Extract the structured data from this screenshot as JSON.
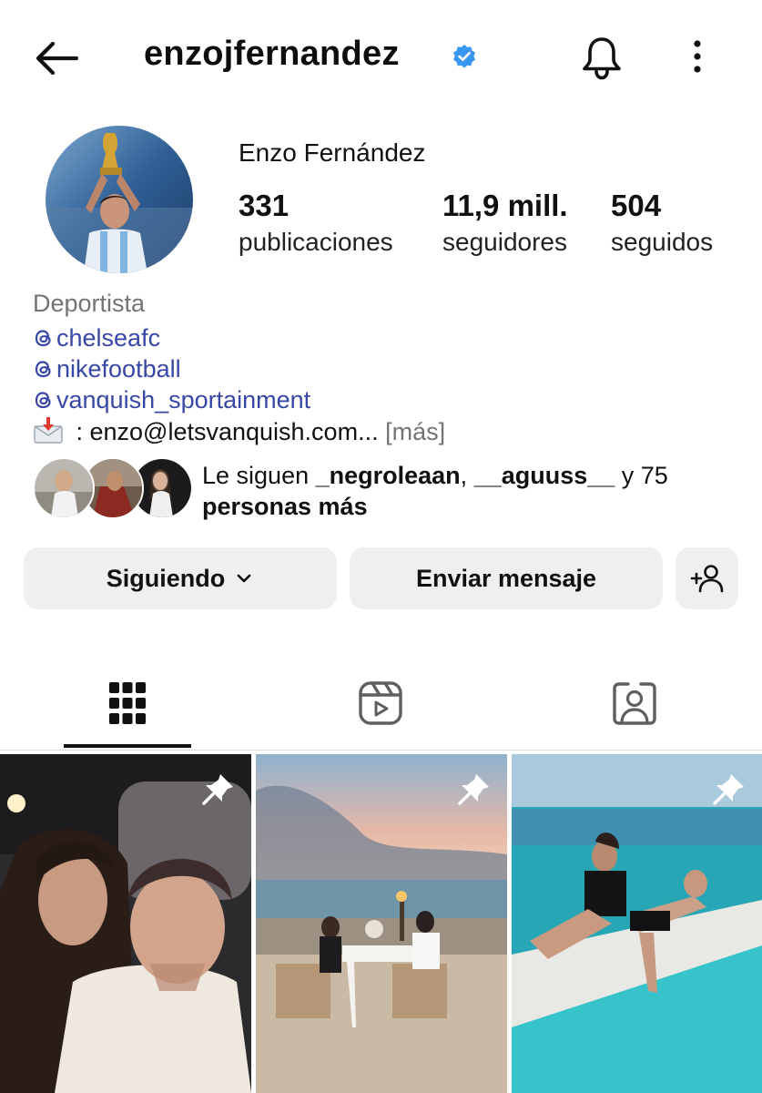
{
  "header": {
    "username": "enzojfernandez",
    "icons": {
      "back": "arrow-left-icon",
      "verified": "verified-badge-icon",
      "notifications": "bell-icon",
      "more": "more-vertical-icon"
    },
    "verified_color": "#3897f0"
  },
  "profile": {
    "full_name": "Enzo Fernández",
    "stats": {
      "posts": {
        "value": "331",
        "label": "publicaciones"
      },
      "followers": {
        "value": "11,9 mill.",
        "label": "seguidores"
      },
      "following": {
        "value": "504",
        "label": "seguidos"
      }
    },
    "category": "Deportista",
    "links": [
      {
        "icon": "threads-icon",
        "text": "chelseafc"
      },
      {
        "icon": "threads-icon",
        "text": "nikefootball"
      },
      {
        "icon": "threads-icon",
        "text": "vanquish_sportainment"
      }
    ],
    "bio_email": " : enzo@letsvanquish.com...",
    "bio_more": "[más]",
    "link_color": "#3847a6",
    "mutual": {
      "prefix": "Le siguen ",
      "user1": "_negroleaan",
      "separator": ", ",
      "user2": "__aguuss__",
      "suffix": " y 75",
      "tail": "personas más"
    }
  },
  "actions": {
    "following_label": "Siguiendo",
    "message_label": "Enviar mensaje",
    "add_user_icon": "add-person-icon"
  },
  "tabs": [
    {
      "name": "grid",
      "icon": "grid-icon",
      "active": true
    },
    {
      "name": "reels",
      "icon": "reels-icon",
      "active": false
    },
    {
      "name": "tagged",
      "icon": "tagged-person-icon",
      "active": false
    }
  ],
  "posts": [
    {
      "pinned": true,
      "icon": "pin-icon"
    },
    {
      "pinned": true,
      "icon": "pin-icon"
    },
    {
      "pinned": true,
      "icon": "pin-icon"
    }
  ]
}
